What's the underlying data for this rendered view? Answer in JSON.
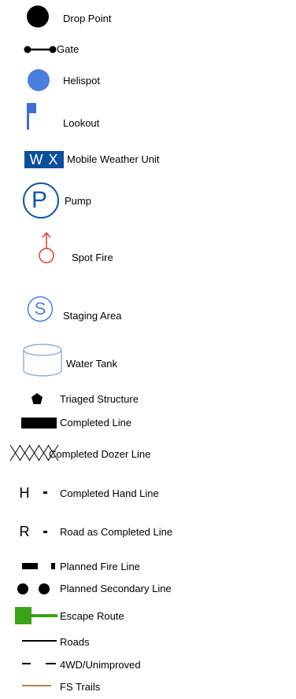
{
  "legend": {
    "drop_point": "Drop Point",
    "gate": "Gate",
    "helispot": "Helispot",
    "lookout": "Lookout",
    "mobile_weather_unit": "Mobile Weather Unit",
    "wx_abbrev": "W X",
    "pump": "Pump",
    "pump_letter": "P",
    "spot_fire": "Spot Fire",
    "staging_area": "Staging Area",
    "staging_letter": "S",
    "water_tank": "Water Tank",
    "triaged_structure": "Triaged Structure",
    "completed_line": "Completed Line",
    "completed_dozer_line": "Completed Dozer Line",
    "hand_letter": "H",
    "completed_hand_line": "Completed Hand Line",
    "road_letter": "R",
    "road_as_completed_line": "Road as Completed Line",
    "planned_fire_line": "Planned Fire Line",
    "planned_secondary_line": "Planned Secondary Line",
    "escape_route": "Escape Route",
    "roads": "Roads",
    "four_wd_unimproved": "4WD/Unimproved",
    "fs_trails": "FS Trails"
  },
  "colors": {
    "black": "#000000",
    "helispot_blue": "#4a7fe0",
    "lookout_blue": "#3a6fd8",
    "wx_blue": "#0b4f9e",
    "pump_blue": "#1155aa",
    "spot_fire_red": "#e8382a",
    "staging_blue": "#4a7fe0",
    "tank_blue": "#7aa0d8",
    "escape_green": "#3aa317",
    "trail_brown": "#8a5a14"
  }
}
